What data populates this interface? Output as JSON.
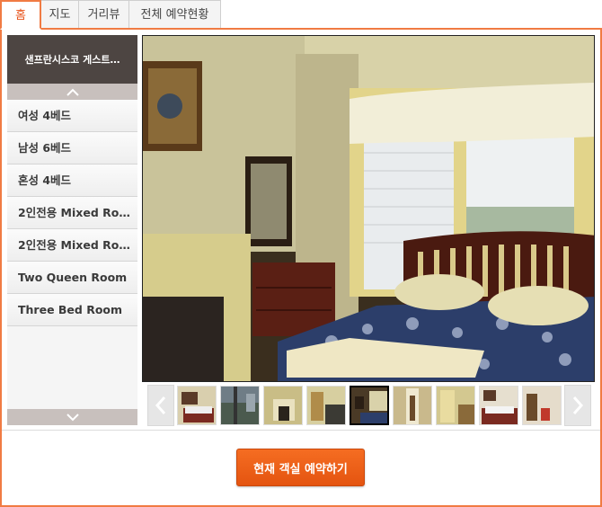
{
  "tabs": [
    {
      "label": "홈",
      "active": true
    },
    {
      "label": "지도",
      "active": false
    },
    {
      "label": "거리뷰",
      "active": false
    },
    {
      "label": "전체 예약현황",
      "active": false
    }
  ],
  "sidebar": {
    "title": "샌프란시스코 게스트…",
    "up_icon": "chevron-up-icon",
    "down_icon": "chevron-down-icon",
    "rooms": [
      {
        "label": "여성 4베드"
      },
      {
        "label": "남성 6베드"
      },
      {
        "label": "혼성 4베드"
      },
      {
        "label": "2인전용 Mixed Roo…"
      },
      {
        "label": "2인전용 Mixed Roo…"
      },
      {
        "label": "Two Queen Room"
      },
      {
        "label": "Three Bed Room"
      }
    ]
  },
  "gallery": {
    "prev_icon": "chevron-left-icon",
    "next_icon": "chevron-right-icon",
    "thumb_count": 9,
    "active_thumb": 5
  },
  "reserve_button": {
    "label": "현재 객실 예약하기"
  },
  "colors": {
    "accent": "#f07b43",
    "button": "#e85a14",
    "sidebar_header": "#4d4542"
  }
}
